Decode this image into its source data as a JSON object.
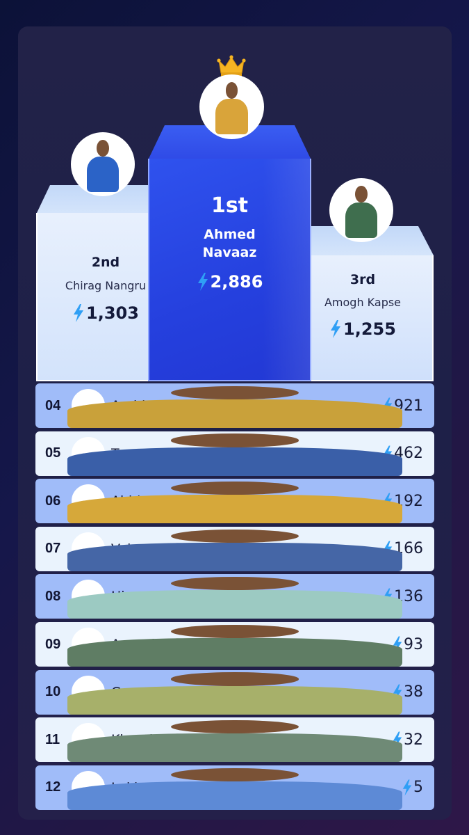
{
  "podium": {
    "first": {
      "rank": "1st",
      "name_line1": "Ahmed",
      "name_line2": "Navaaz",
      "score": "2,886",
      "jersey": "#d9a43a"
    },
    "second": {
      "rank": "2nd",
      "name": "Chirag Nangru",
      "score": "1,303",
      "jersey": "#2b63c7"
    },
    "third": {
      "rank": "3rd",
      "name": "Amogh Kapse",
      "score": "1,255",
      "jersey": "#3f6e4e"
    }
  },
  "leaderboard": [
    {
      "rank": "04",
      "name": "Arohi Khurana",
      "score": "921",
      "jersey": "#c9a13a"
    },
    {
      "rank": "05",
      "name": "Tanu Rawat",
      "score": "462",
      "jersey": "#3a5fa8"
    },
    {
      "rank": "06",
      "name": "Abhinav Shukla",
      "score": "192",
      "jersey": "#d6a83a"
    },
    {
      "rank": "07",
      "name": "Valence Kundra",
      "score": "166",
      "jersey": "#4566a6"
    },
    {
      "rank": "08",
      "name": "Himanshu Arora",
      "score": "136",
      "jersey": "#9ccac2"
    },
    {
      "rank": "09",
      "name": "Aayush Sarvaiya",
      "score": "93",
      "jersey": "#5f7d64"
    },
    {
      "rank": "10",
      "name": "Gaurav Singh",
      "score": "38",
      "jersey": "#a7b06a"
    },
    {
      "rank": "11",
      "name": "Khyati Sharma",
      "score": "32",
      "jersey": "#6f8a76"
    },
    {
      "rank": "12",
      "name": "Lekha Nair",
      "score": "5",
      "jersey": "#5d8ad6"
    }
  ],
  "colors": {
    "bolt": "#2f9ff5",
    "row_dark": "#a0bcf9",
    "row_light": "#eaf3fd",
    "first_block": "#2a47e3"
  },
  "icons": {
    "points": "lightning-bolt-icon",
    "top_rank": "crown-icon"
  }
}
